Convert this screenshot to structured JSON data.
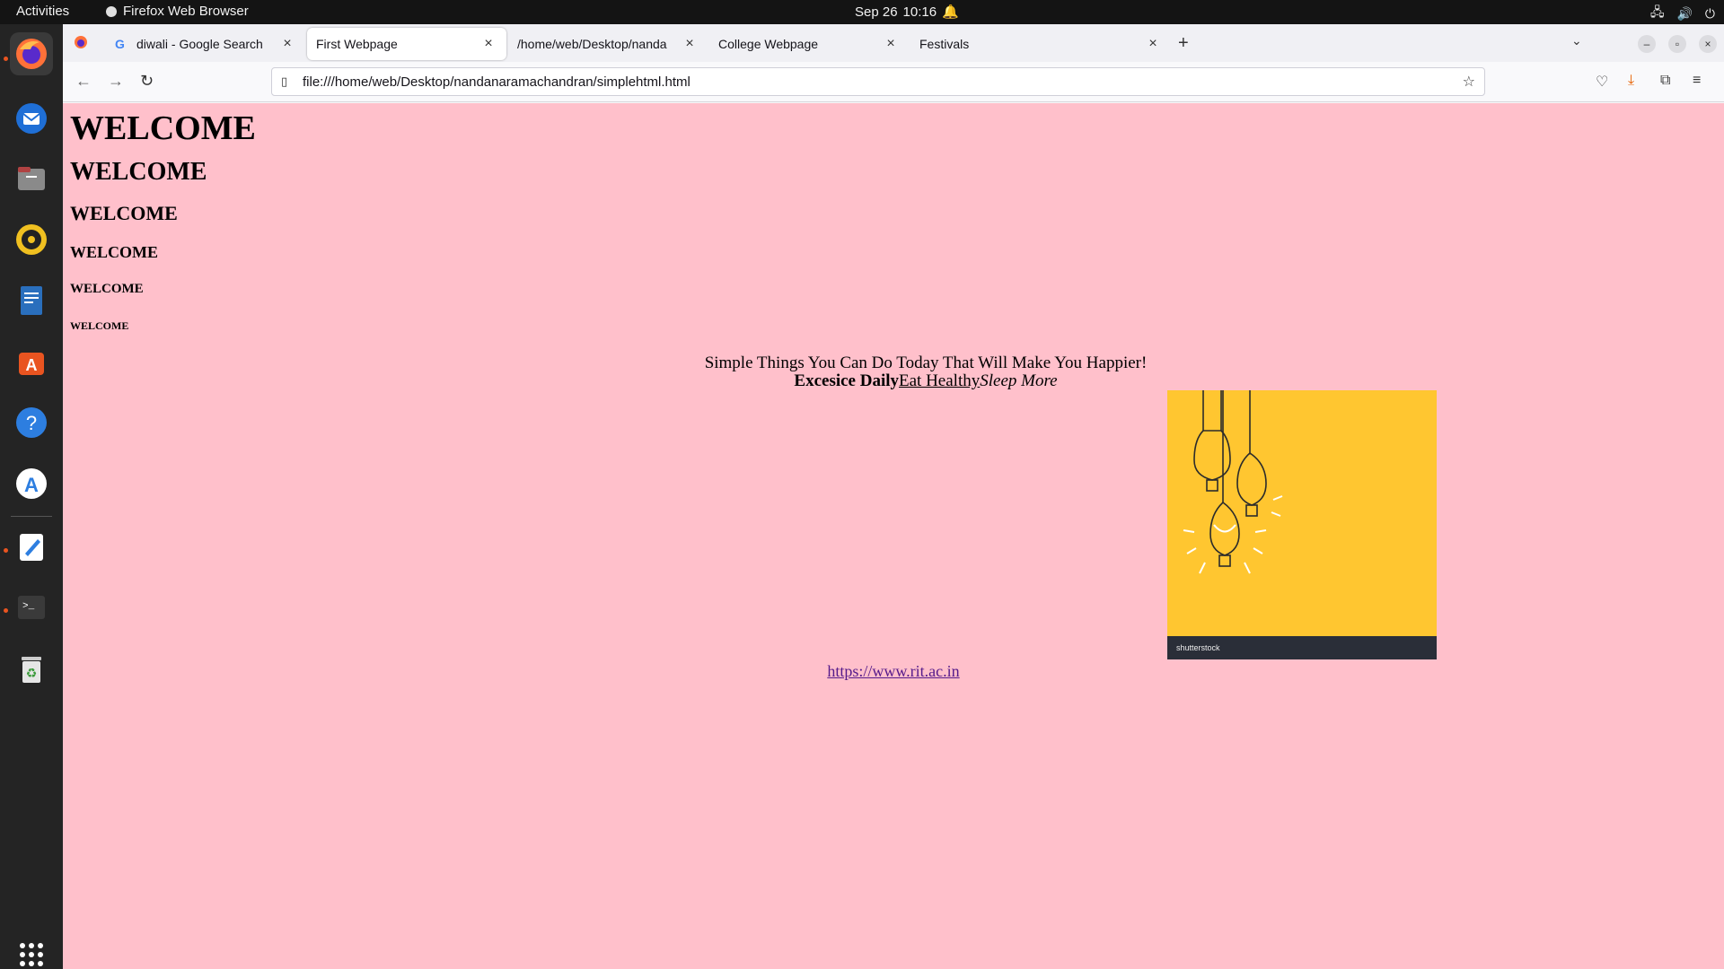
{
  "topbar": {
    "activities": "Activities",
    "app_name": "Firefox Web Browser",
    "date": "Sep 26",
    "time": "10:16"
  },
  "dock": {
    "items": [
      "firefox-icon",
      "thunderbird-icon",
      "files-icon",
      "rhythmbox-icon",
      "libreoffice-writer-icon",
      "software-icon",
      "help-icon",
      "app-center-icon",
      "text-editor-icon",
      "terminal-icon",
      "trash-icon",
      "show-apps-icon"
    ]
  },
  "tabs": [
    {
      "title": "diwali - Google Search"
    },
    {
      "title": "First Webpage"
    },
    {
      "title": "/home/web/Desktop/nanda"
    },
    {
      "title": "College Webpage"
    },
    {
      "title": "Festivals"
    }
  ],
  "url": "file:///home/web/Desktop/nandanaramachandran/simplehtml.html",
  "page": {
    "headings": [
      "WELCOME",
      "WELCOME",
      "WELCOME",
      "WELCOME",
      "WELCOME",
      "WELCOME"
    ],
    "tagline": "Simple Things You Can Do Today That Will Make You Happier!",
    "bold_text": "Excesice Daily",
    "underline_text": "Eat Healthy",
    "italic_text": "Sleep More",
    "image_watermark": "shutterstock",
    "link": "https://www.rit.ac.in"
  },
  "colors": {
    "page_background": "#ffc0cb",
    "image_background": "#ffc630",
    "link_color": "#551a8b"
  }
}
